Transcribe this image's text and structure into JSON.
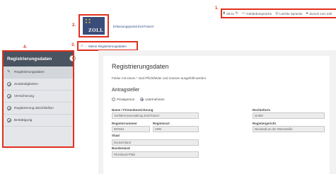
{
  "annotations": [
    "1.",
    "2.",
    "3.",
    "4."
  ],
  "topbar": {
    "timer": "29:41",
    "sign_language": "Gebärdensprache",
    "easy_language": "Leichte Sprache",
    "back_to_customs": "Zurück zum Zoll"
  },
  "logo": {
    "text": "ZOLL"
  },
  "header": {
    "portal_title": "Erfassungsportal ExSTransV"
  },
  "breadcrumb": {
    "current": "Meine Registrierungsdaten"
  },
  "sidebar": {
    "title": "Registrierungsdaten",
    "items": [
      {
        "label": "Registrierungsdaten",
        "icon": "pencil-icon"
      },
      {
        "label": "Zuständigkeiten",
        "icon": "circle-slash-icon"
      },
      {
        "label": "Versicherung",
        "icon": "circle-slash-icon"
      },
      {
        "label": "Registrierung abschließen",
        "icon": "circle-slash-icon"
      },
      {
        "label": "Bestätigung",
        "icon": "circle-slash-icon"
      }
    ]
  },
  "form": {
    "title": "Registrierungsdaten",
    "hint": "Felder mit einem * sind Pflichtfelder und müssen ausgefüllt werden.",
    "applicant_heading": "Antragsteller",
    "radio_private": "Privatperson",
    "radio_company": "Unternehmen",
    "name_label": "Name / Firmenbezeichnung",
    "name_value": "Verfahrensverwaltung ExSTransV",
    "legal_form_label": "Rechtsform",
    "legal_form_value": "GmbH",
    "reg_number_label": "Registernummer",
    "reg_number_value": "987654",
    "reg_type_label": "Registerart",
    "reg_type_value": "HRB",
    "reg_court_label": "Registergericht",
    "reg_court_value": "Neustadt an der Weinstraße",
    "state_label": "Staat",
    "state_value": "Deutschland",
    "federal_state_label": "Bundesland",
    "federal_state_value": "Rheinland-Pfalz"
  },
  "colors": {
    "annotation_red": "#e0301e",
    "sidebar_header": "#4a5460",
    "link_blue": "#2f4b8a"
  }
}
